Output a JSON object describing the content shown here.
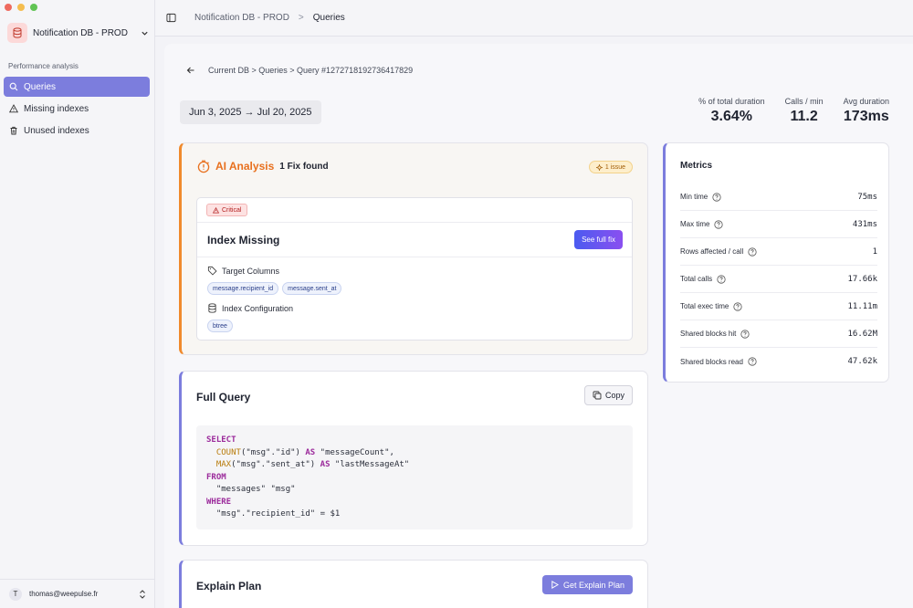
{
  "window": {
    "colors": {
      "close": "#ee6a5f",
      "minimize": "#f5bd4f",
      "maximize": "#61c454"
    }
  },
  "sidebar": {
    "db_name": "Notification DB - PROD",
    "section_label": "Performance analysis",
    "items": [
      {
        "label": "Queries",
        "icon": "search-icon",
        "active": true
      },
      {
        "label": "Missing indexes",
        "icon": "warning-icon",
        "active": false
      },
      {
        "label": "Unused indexes",
        "icon": "trash-icon",
        "active": false
      }
    ],
    "user": {
      "initial": "T",
      "email": "thomas@weepulse.fr"
    }
  },
  "topbar": {
    "crumbs": [
      "Notification DB - PROD",
      "Queries"
    ],
    "separator": ">"
  },
  "page": {
    "breadcrumb": "Current DB > Queries > Query #1272718192736417829",
    "date_range": "Jun 3, 2025 → Jul 20, 2025",
    "stats": [
      {
        "label": "% of total duration",
        "value": "3.64%"
      },
      {
        "label": "Calls / min",
        "value": "11.2"
      },
      {
        "label": "Avg duration",
        "value": "173ms"
      }
    ]
  },
  "ai_analysis": {
    "title": "AI Analysis",
    "fix_count": "1 Fix found",
    "issue_badge": "1 issue",
    "issue": {
      "severity": "Critical",
      "title": "Index Missing",
      "fix_button": "See full fix",
      "target_columns_label": "Target Columns",
      "target_columns": [
        "message.recipient_id",
        "message.sent_at"
      ],
      "index_config_label": "Index Configuration",
      "index_config": [
        "btree"
      ]
    }
  },
  "metrics": {
    "title": "Metrics",
    "rows": [
      {
        "label": "Min time",
        "value": "75ms"
      },
      {
        "label": "Max time",
        "value": "431ms"
      },
      {
        "label": "Rows affected / call",
        "value": "1"
      },
      {
        "label": "Total calls",
        "value": "17.66k"
      },
      {
        "label": "Total exec time",
        "value": "11.11m"
      },
      {
        "label": "Shared blocks hit",
        "value": "16.62M"
      },
      {
        "label": "Shared blocks read",
        "value": "47.62k"
      }
    ]
  },
  "full_query": {
    "title": "Full Query",
    "copy_label": "Copy",
    "lines": [
      [
        {
          "t": "SELECT",
          "c": "kw"
        }
      ],
      [
        {
          "t": "  "
        },
        {
          "t": "COUNT",
          "c": "fn"
        },
        {
          "t": "(\"msg\".\"id\") "
        },
        {
          "t": "AS",
          "c": "kw"
        },
        {
          "t": " \"messageCount\","
        }
      ],
      [
        {
          "t": "  "
        },
        {
          "t": "MAX",
          "c": "fn"
        },
        {
          "t": "(\"msg\".\"sent_at\") "
        },
        {
          "t": "AS",
          "c": "kw"
        },
        {
          "t": " \"lastMessageAt\""
        }
      ],
      [
        {
          "t": "FROM",
          "c": "kw"
        }
      ],
      [
        {
          "t": "  \"messages\" \"msg\""
        }
      ],
      [
        {
          "t": "WHERE",
          "c": "kw"
        }
      ],
      [
        {
          "t": "  \"msg\".\"recipient_id\" = $1"
        }
      ]
    ]
  },
  "explain_plan": {
    "title": "Explain Plan",
    "button": "Get Explain Plan"
  }
}
